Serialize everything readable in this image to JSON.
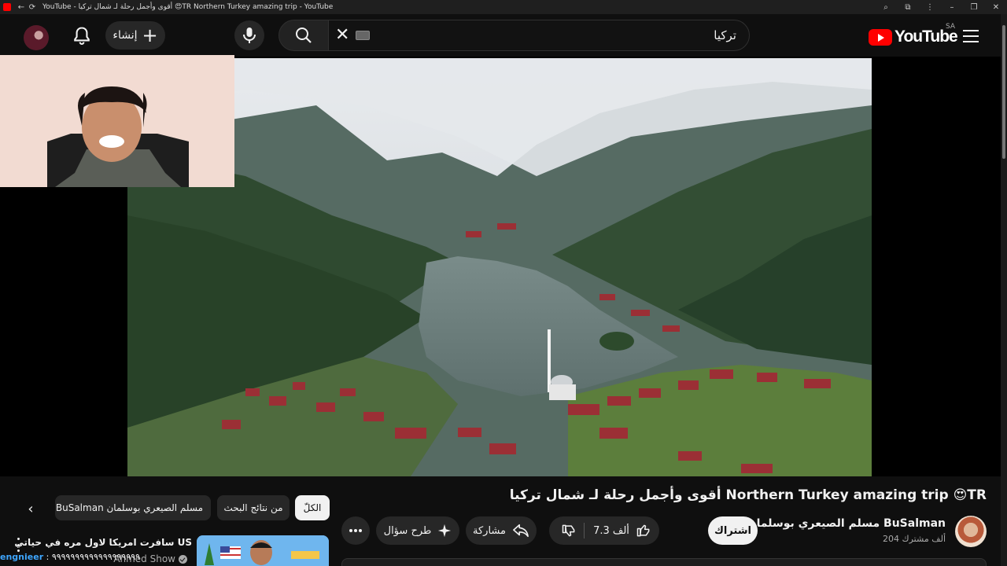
{
  "browser": {
    "tab_title": "YouTube - أقوى وأجمل رحلة لـ شمال تركيا 😍TR Northern Turkey amazing trip - YouTube"
  },
  "masthead": {
    "create_label": "إنشاء",
    "search_query": "تركيا",
    "logo_text": "YouTube",
    "country_code": "SA"
  },
  "video": {
    "title": "أقوى وأجمل رحلة لـ شمال تركيا Northern Turkey amazing trip 😍TR",
    "channel_name": "مسلم الصيعري بوسلمان BuSalman",
    "subscribers": "204 ألف مشترك",
    "subscribe_label": "اشتراك",
    "likes": "7.3 ألف",
    "share_label": "مشاركة",
    "ask_label": "طرح سؤال"
  },
  "chips": {
    "all": "الكلّ",
    "from_results": "من نتائج البحث",
    "from_channel": "من BuSalman مسلم الصيعري بوسلمان"
  },
  "recommended": [
    {
      "title": "سافرت امريكا لاول مره في حياتي US",
      "channel": "Ahmed Show"
    }
  ],
  "comment_ticker": {
    "name": "engnieer",
    "text": ": ٩٩٩٩٩٩٩٩٩٩٩٩٩٩٩٩٩٩٩"
  },
  "icons": {
    "bell": "notifications-bell-icon",
    "mic": "microphone-icon",
    "search": "search-icon",
    "clear": "close-icon",
    "keyboard": "keyboard-icon",
    "menu": "hamburger-menu-icon",
    "like": "thumbs-up-icon",
    "dislike": "thumbs-down-icon",
    "share": "share-arrow-icon",
    "ask": "sparkle-icon",
    "more": "more-horizontal-icon"
  },
  "colors": {
    "background": "#0f0f0f",
    "surface": "#272727",
    "brand_red": "#ff0000",
    "link_blue": "#3ea6ff"
  }
}
